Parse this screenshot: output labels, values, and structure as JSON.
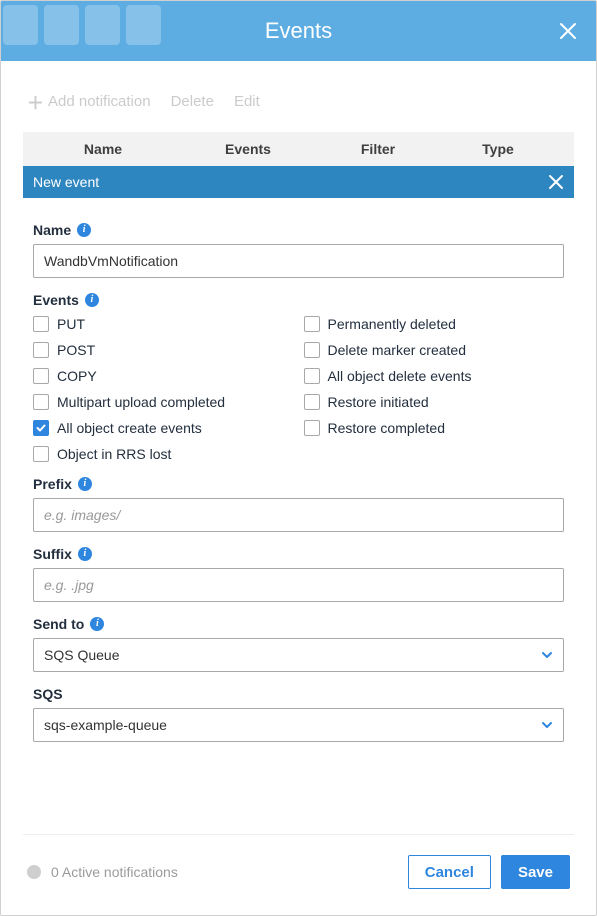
{
  "header": {
    "title": "Events"
  },
  "toolbar": {
    "add_label": "Add notification",
    "delete_label": "Delete",
    "edit_label": "Edit"
  },
  "table": {
    "columns": {
      "name": "Name",
      "events": "Events",
      "filter": "Filter",
      "type": "Type"
    }
  },
  "new_event": {
    "bar_label": "New event"
  },
  "form": {
    "name": {
      "label": "Name",
      "value": "WandbVmNotification"
    },
    "events": {
      "label": "Events",
      "left": [
        {
          "label": "PUT",
          "checked": false
        },
        {
          "label": "POST",
          "checked": false
        },
        {
          "label": "COPY",
          "checked": false
        },
        {
          "label": "Multipart upload completed",
          "checked": false
        },
        {
          "label": "All object create events",
          "checked": true
        },
        {
          "label": "Object in RRS lost",
          "checked": false
        }
      ],
      "right": [
        {
          "label": "Permanently deleted",
          "checked": false
        },
        {
          "label": "Delete marker created",
          "checked": false
        },
        {
          "label": "All object delete events",
          "checked": false
        },
        {
          "label": "Restore initiated",
          "checked": false
        },
        {
          "label": "Restore completed",
          "checked": false
        }
      ]
    },
    "prefix": {
      "label": "Prefix",
      "placeholder": "e.g. images/",
      "value": ""
    },
    "suffix": {
      "label": "Suffix",
      "placeholder": "e.g. .jpg",
      "value": ""
    },
    "send_to": {
      "label": "Send to",
      "selected": "SQS Queue"
    },
    "sqs": {
      "label": "SQS",
      "selected": "sqs-example-queue"
    }
  },
  "footer": {
    "status": "0 Active notifications",
    "cancel": "Cancel",
    "save": "Save"
  }
}
